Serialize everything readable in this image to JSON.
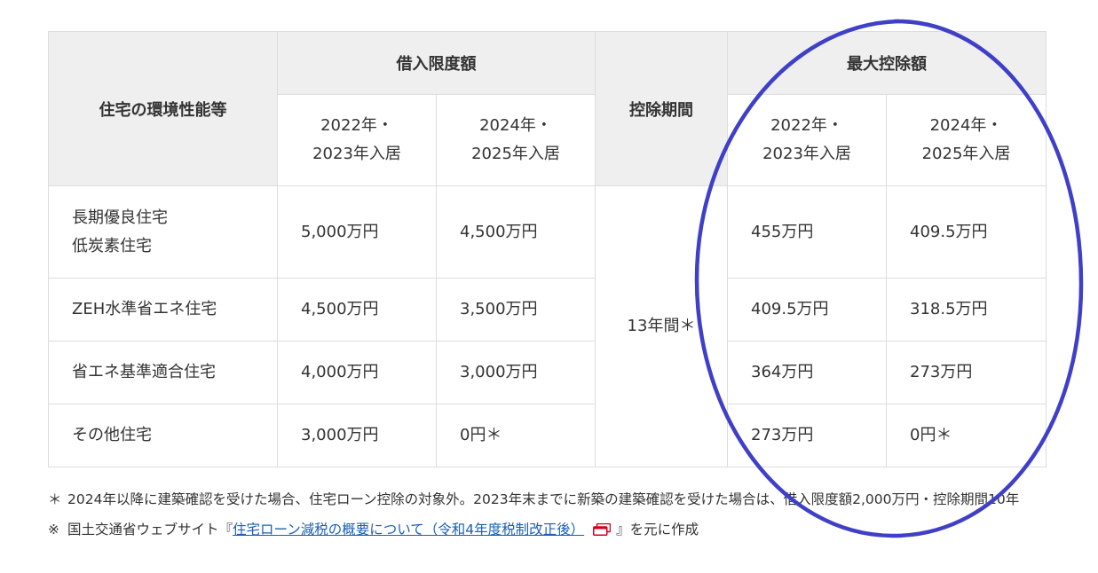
{
  "table": {
    "header": {
      "col_env": "住宅の環境性能等",
      "group_limit": "借入限度額",
      "col_period": "控除期間",
      "group_max": "最大控除額",
      "year_a_line1": "2022年・",
      "year_a_line2": "2023年入居",
      "year_b_line1": "2024年・",
      "year_b_line2": "2025年入居"
    },
    "period_value": "13年間＊",
    "rows": [
      {
        "name_line1": "長期優良住宅",
        "name_line2": "低炭素住宅",
        "limit_a": "5,000万円",
        "limit_b": "4,500万円",
        "max_a": "455万円",
        "max_b": "409.5万円"
      },
      {
        "name_line1": "ZEH水準省エネ住宅",
        "name_line2": "",
        "limit_a": "4,500万円",
        "limit_b": "3,500万円",
        "max_a": "409.5万円",
        "max_b": "318.5万円"
      },
      {
        "name_line1": "省エネ基準適合住宅",
        "name_line2": "",
        "limit_a": "4,000万円",
        "limit_b": "3,000万円",
        "max_a": "364万円",
        "max_b": "273万円"
      },
      {
        "name_line1": "その他住宅",
        "name_line2": "",
        "limit_a": "3,000万円",
        "limit_b": "0円＊",
        "max_a": "273万円",
        "max_b": "0円＊"
      }
    ]
  },
  "notes": {
    "asterisk_mark": "＊",
    "asterisk_text": "2024年以降に建築確認を受けた場合、住宅ローン控除の対象外。2023年末までに新築の建築確認を受けた場合は、借入限度額2,000万円・控除期間10年",
    "source_mark": "※",
    "source_prefix": "国土交通省ウェブサイト『",
    "source_link": "住宅ローン減税の概要について（令和4年度税制改正後）",
    "source_suffix": "』を元に作成"
  },
  "colors": {
    "circle": "#3f3fc8",
    "link": "#1a5fb4",
    "pdf_icon": "#d0021b",
    "header_bg": "#efefef",
    "border": "#dddddd"
  },
  "icons": {
    "pdf": "pdf-icon"
  }
}
